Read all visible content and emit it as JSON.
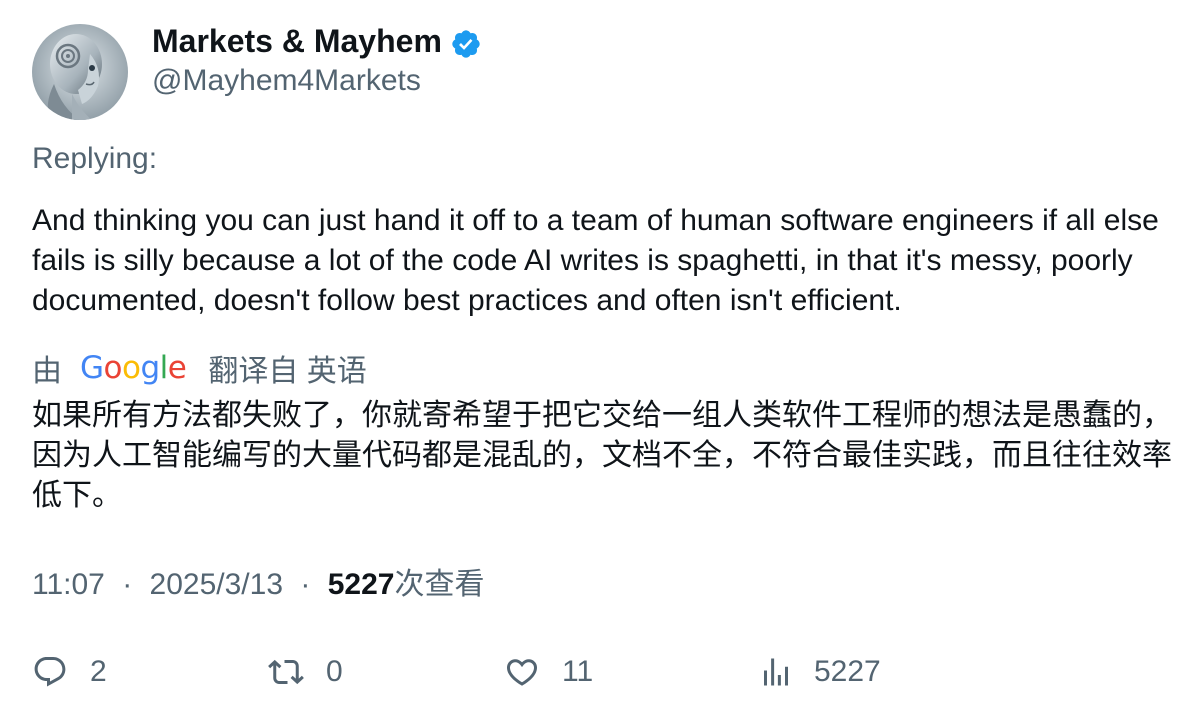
{
  "author": {
    "display_name": "Markets & Mayhem",
    "handle": "@Mayhem4Markets",
    "verified": true,
    "verified_color": "#1d9bf0"
  },
  "tweet": {
    "replying_label": "Replying:",
    "body": "And thinking you can just hand it off to a team of human software engineers if all else fails is silly because a lot of the code AI writes is spaghetti, in that it's messy, poorly documented, doesn't follow best practices and often isn't efficient.",
    "translate": {
      "by_label": "由",
      "provider": "Google",
      "from_label": "翻译自 英语"
    },
    "translated_body": "如果所有方法都失败了，你就寄希望于把它交给一组人类软件工程师的想法是愚蠢的，因为人工智能编写的大量代码都是混乱的，文档不全，不符合最佳实践，而且往往效率低下。",
    "time": "11:07",
    "separator": "·",
    "date": "2025/3/13",
    "views_count": "5227",
    "views_label": "次查看"
  },
  "actions": {
    "reply_count": "2",
    "retweet_count": "0",
    "like_count": "11",
    "views_count": "5227"
  },
  "colors": {
    "text_primary": "#0f1419",
    "text_secondary": "#536471",
    "google_blue": "#4285f4",
    "google_red": "#ea4335",
    "google_yellow": "#fbbc05",
    "google_green": "#34a853"
  },
  "icons": {
    "reply": "reply-icon",
    "retweet": "retweet-icon",
    "like": "heart-icon",
    "views": "views-chart-icon"
  }
}
